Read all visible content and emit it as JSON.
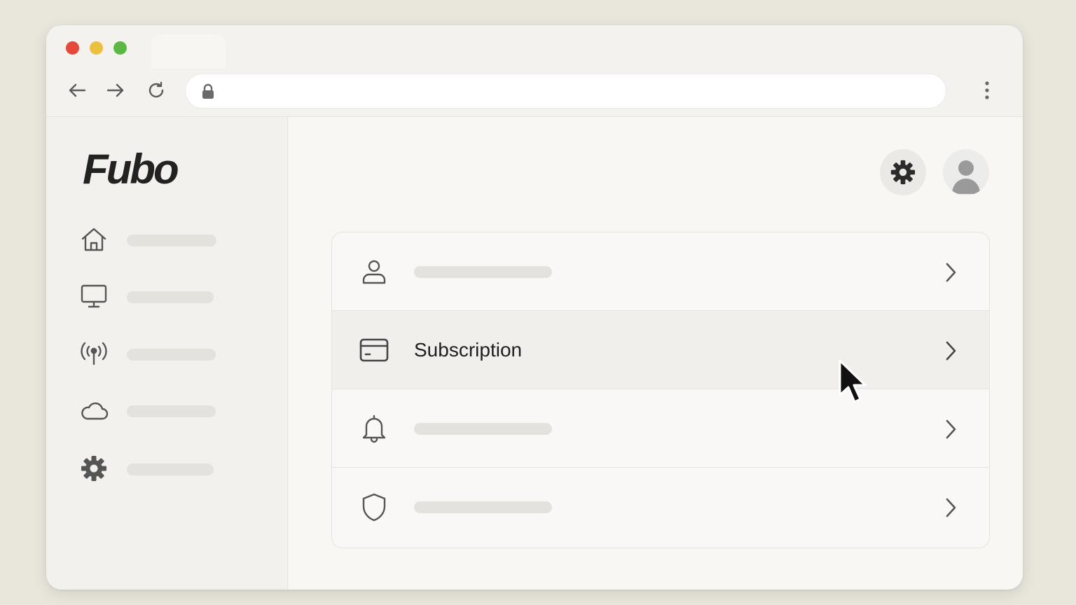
{
  "browser": {
    "url": "",
    "window_controls": [
      "close",
      "minimize",
      "maximize"
    ]
  },
  "brand": {
    "logo_text": "Fubo"
  },
  "sidebar": {
    "items": [
      {
        "icon": "home-icon",
        "label": ""
      },
      {
        "icon": "monitor-icon",
        "label": ""
      },
      {
        "icon": "broadcast-icon",
        "label": ""
      },
      {
        "icon": "cloud-icon",
        "label": ""
      },
      {
        "icon": "gear-icon",
        "label": ""
      }
    ]
  },
  "header": {
    "settings_icon": "gear-icon",
    "avatar_icon": "user-avatar-icon"
  },
  "settings_list": {
    "rows": [
      {
        "icon": "user-icon",
        "label": ""
      },
      {
        "icon": "credit-card-icon",
        "label": "Subscription",
        "highlighted": true
      },
      {
        "icon": "bell-icon",
        "label": ""
      },
      {
        "icon": "shield-icon",
        "label": ""
      }
    ]
  },
  "colors": {
    "background": "#e9e6dc",
    "window": "#f3f2ee",
    "placeholder_bar": "#e4e2dd",
    "hover_row": "#f0efec",
    "traffic_red": "#e5493a",
    "traffic_yellow": "#ecc03f",
    "traffic_green": "#5bb844"
  }
}
